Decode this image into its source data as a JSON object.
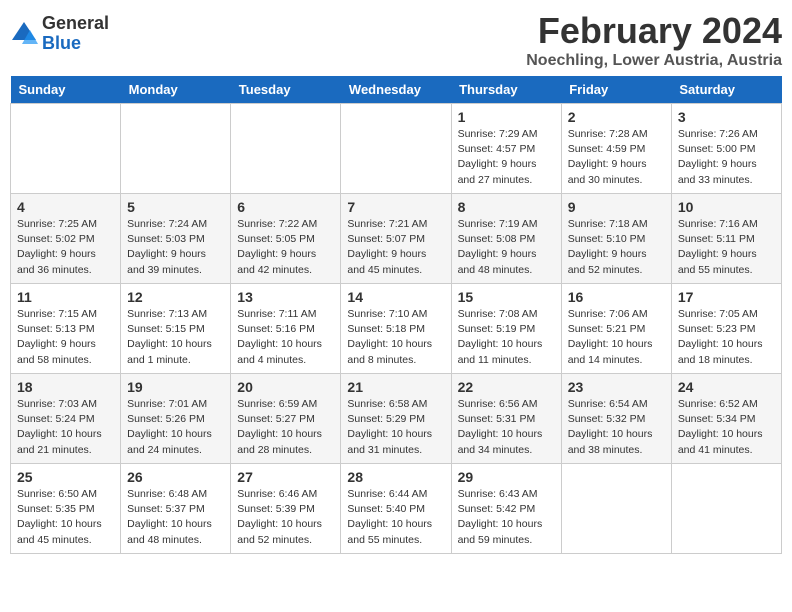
{
  "logo": {
    "general": "General",
    "blue": "Blue"
  },
  "title": "February 2024",
  "location": "Noechling, Lower Austria, Austria",
  "days_of_week": [
    "Sunday",
    "Monday",
    "Tuesday",
    "Wednesday",
    "Thursday",
    "Friday",
    "Saturday"
  ],
  "weeks": [
    [
      {
        "day": "",
        "info": ""
      },
      {
        "day": "",
        "info": ""
      },
      {
        "day": "",
        "info": ""
      },
      {
        "day": "",
        "info": ""
      },
      {
        "day": "1",
        "info": "Sunrise: 7:29 AM\nSunset: 4:57 PM\nDaylight: 9 hours\nand 27 minutes."
      },
      {
        "day": "2",
        "info": "Sunrise: 7:28 AM\nSunset: 4:59 PM\nDaylight: 9 hours\nand 30 minutes."
      },
      {
        "day": "3",
        "info": "Sunrise: 7:26 AM\nSunset: 5:00 PM\nDaylight: 9 hours\nand 33 minutes."
      }
    ],
    [
      {
        "day": "4",
        "info": "Sunrise: 7:25 AM\nSunset: 5:02 PM\nDaylight: 9 hours\nand 36 minutes."
      },
      {
        "day": "5",
        "info": "Sunrise: 7:24 AM\nSunset: 5:03 PM\nDaylight: 9 hours\nand 39 minutes."
      },
      {
        "day": "6",
        "info": "Sunrise: 7:22 AM\nSunset: 5:05 PM\nDaylight: 9 hours\nand 42 minutes."
      },
      {
        "day": "7",
        "info": "Sunrise: 7:21 AM\nSunset: 5:07 PM\nDaylight: 9 hours\nand 45 minutes."
      },
      {
        "day": "8",
        "info": "Sunrise: 7:19 AM\nSunset: 5:08 PM\nDaylight: 9 hours\nand 48 minutes."
      },
      {
        "day": "9",
        "info": "Sunrise: 7:18 AM\nSunset: 5:10 PM\nDaylight: 9 hours\nand 52 minutes."
      },
      {
        "day": "10",
        "info": "Sunrise: 7:16 AM\nSunset: 5:11 PM\nDaylight: 9 hours\nand 55 minutes."
      }
    ],
    [
      {
        "day": "11",
        "info": "Sunrise: 7:15 AM\nSunset: 5:13 PM\nDaylight: 9 hours\nand 58 minutes."
      },
      {
        "day": "12",
        "info": "Sunrise: 7:13 AM\nSunset: 5:15 PM\nDaylight: 10 hours\nand 1 minute."
      },
      {
        "day": "13",
        "info": "Sunrise: 7:11 AM\nSunset: 5:16 PM\nDaylight: 10 hours\nand 4 minutes."
      },
      {
        "day": "14",
        "info": "Sunrise: 7:10 AM\nSunset: 5:18 PM\nDaylight: 10 hours\nand 8 minutes."
      },
      {
        "day": "15",
        "info": "Sunrise: 7:08 AM\nSunset: 5:19 PM\nDaylight: 10 hours\nand 11 minutes."
      },
      {
        "day": "16",
        "info": "Sunrise: 7:06 AM\nSunset: 5:21 PM\nDaylight: 10 hours\nand 14 minutes."
      },
      {
        "day": "17",
        "info": "Sunrise: 7:05 AM\nSunset: 5:23 PM\nDaylight: 10 hours\nand 18 minutes."
      }
    ],
    [
      {
        "day": "18",
        "info": "Sunrise: 7:03 AM\nSunset: 5:24 PM\nDaylight: 10 hours\nand 21 minutes."
      },
      {
        "day": "19",
        "info": "Sunrise: 7:01 AM\nSunset: 5:26 PM\nDaylight: 10 hours\nand 24 minutes."
      },
      {
        "day": "20",
        "info": "Sunrise: 6:59 AM\nSunset: 5:27 PM\nDaylight: 10 hours\nand 28 minutes."
      },
      {
        "day": "21",
        "info": "Sunrise: 6:58 AM\nSunset: 5:29 PM\nDaylight: 10 hours\nand 31 minutes."
      },
      {
        "day": "22",
        "info": "Sunrise: 6:56 AM\nSunset: 5:31 PM\nDaylight: 10 hours\nand 34 minutes."
      },
      {
        "day": "23",
        "info": "Sunrise: 6:54 AM\nSunset: 5:32 PM\nDaylight: 10 hours\nand 38 minutes."
      },
      {
        "day": "24",
        "info": "Sunrise: 6:52 AM\nSunset: 5:34 PM\nDaylight: 10 hours\nand 41 minutes."
      }
    ],
    [
      {
        "day": "25",
        "info": "Sunrise: 6:50 AM\nSunset: 5:35 PM\nDaylight: 10 hours\nand 45 minutes."
      },
      {
        "day": "26",
        "info": "Sunrise: 6:48 AM\nSunset: 5:37 PM\nDaylight: 10 hours\nand 48 minutes."
      },
      {
        "day": "27",
        "info": "Sunrise: 6:46 AM\nSunset: 5:39 PM\nDaylight: 10 hours\nand 52 minutes."
      },
      {
        "day": "28",
        "info": "Sunrise: 6:44 AM\nSunset: 5:40 PM\nDaylight: 10 hours\nand 55 minutes."
      },
      {
        "day": "29",
        "info": "Sunrise: 6:43 AM\nSunset: 5:42 PM\nDaylight: 10 hours\nand 59 minutes."
      },
      {
        "day": "",
        "info": ""
      },
      {
        "day": "",
        "info": ""
      }
    ]
  ]
}
